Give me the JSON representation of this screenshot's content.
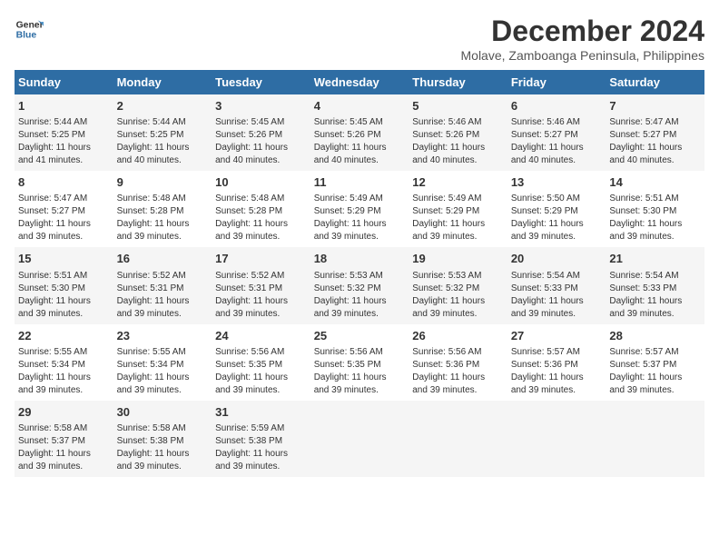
{
  "header": {
    "logo_line1": "General",
    "logo_line2": "Blue",
    "title": "December 2024",
    "subtitle": "Molave, Zamboanga Peninsula, Philippines"
  },
  "calendar": {
    "weekdays": [
      "Sunday",
      "Monday",
      "Tuesday",
      "Wednesday",
      "Thursday",
      "Friday",
      "Saturday"
    ],
    "weeks": [
      [
        {
          "day": "1",
          "info": "Sunrise: 5:44 AM\nSunset: 5:25 PM\nDaylight: 11 hours\nand 41 minutes."
        },
        {
          "day": "2",
          "info": "Sunrise: 5:44 AM\nSunset: 5:25 PM\nDaylight: 11 hours\nand 40 minutes."
        },
        {
          "day": "3",
          "info": "Sunrise: 5:45 AM\nSunset: 5:26 PM\nDaylight: 11 hours\nand 40 minutes."
        },
        {
          "day": "4",
          "info": "Sunrise: 5:45 AM\nSunset: 5:26 PM\nDaylight: 11 hours\nand 40 minutes."
        },
        {
          "day": "5",
          "info": "Sunrise: 5:46 AM\nSunset: 5:26 PM\nDaylight: 11 hours\nand 40 minutes."
        },
        {
          "day": "6",
          "info": "Sunrise: 5:46 AM\nSunset: 5:27 PM\nDaylight: 11 hours\nand 40 minutes."
        },
        {
          "day": "7",
          "info": "Sunrise: 5:47 AM\nSunset: 5:27 PM\nDaylight: 11 hours\nand 40 minutes."
        }
      ],
      [
        {
          "day": "8",
          "info": "Sunrise: 5:47 AM\nSunset: 5:27 PM\nDaylight: 11 hours\nand 39 minutes."
        },
        {
          "day": "9",
          "info": "Sunrise: 5:48 AM\nSunset: 5:28 PM\nDaylight: 11 hours\nand 39 minutes."
        },
        {
          "day": "10",
          "info": "Sunrise: 5:48 AM\nSunset: 5:28 PM\nDaylight: 11 hours\nand 39 minutes."
        },
        {
          "day": "11",
          "info": "Sunrise: 5:49 AM\nSunset: 5:29 PM\nDaylight: 11 hours\nand 39 minutes."
        },
        {
          "day": "12",
          "info": "Sunrise: 5:49 AM\nSunset: 5:29 PM\nDaylight: 11 hours\nand 39 minutes."
        },
        {
          "day": "13",
          "info": "Sunrise: 5:50 AM\nSunset: 5:29 PM\nDaylight: 11 hours\nand 39 minutes."
        },
        {
          "day": "14",
          "info": "Sunrise: 5:51 AM\nSunset: 5:30 PM\nDaylight: 11 hours\nand 39 minutes."
        }
      ],
      [
        {
          "day": "15",
          "info": "Sunrise: 5:51 AM\nSunset: 5:30 PM\nDaylight: 11 hours\nand 39 minutes."
        },
        {
          "day": "16",
          "info": "Sunrise: 5:52 AM\nSunset: 5:31 PM\nDaylight: 11 hours\nand 39 minutes."
        },
        {
          "day": "17",
          "info": "Sunrise: 5:52 AM\nSunset: 5:31 PM\nDaylight: 11 hours\nand 39 minutes."
        },
        {
          "day": "18",
          "info": "Sunrise: 5:53 AM\nSunset: 5:32 PM\nDaylight: 11 hours\nand 39 minutes."
        },
        {
          "day": "19",
          "info": "Sunrise: 5:53 AM\nSunset: 5:32 PM\nDaylight: 11 hours\nand 39 minutes."
        },
        {
          "day": "20",
          "info": "Sunrise: 5:54 AM\nSunset: 5:33 PM\nDaylight: 11 hours\nand 39 minutes."
        },
        {
          "day": "21",
          "info": "Sunrise: 5:54 AM\nSunset: 5:33 PM\nDaylight: 11 hours\nand 39 minutes."
        }
      ],
      [
        {
          "day": "22",
          "info": "Sunrise: 5:55 AM\nSunset: 5:34 PM\nDaylight: 11 hours\nand 39 minutes."
        },
        {
          "day": "23",
          "info": "Sunrise: 5:55 AM\nSunset: 5:34 PM\nDaylight: 11 hours\nand 39 minutes."
        },
        {
          "day": "24",
          "info": "Sunrise: 5:56 AM\nSunset: 5:35 PM\nDaylight: 11 hours\nand 39 minutes."
        },
        {
          "day": "25",
          "info": "Sunrise: 5:56 AM\nSunset: 5:35 PM\nDaylight: 11 hours\nand 39 minutes."
        },
        {
          "day": "26",
          "info": "Sunrise: 5:56 AM\nSunset: 5:36 PM\nDaylight: 11 hours\nand 39 minutes."
        },
        {
          "day": "27",
          "info": "Sunrise: 5:57 AM\nSunset: 5:36 PM\nDaylight: 11 hours\nand 39 minutes."
        },
        {
          "day": "28",
          "info": "Sunrise: 5:57 AM\nSunset: 5:37 PM\nDaylight: 11 hours\nand 39 minutes."
        }
      ],
      [
        {
          "day": "29",
          "info": "Sunrise: 5:58 AM\nSunset: 5:37 PM\nDaylight: 11 hours\nand 39 minutes."
        },
        {
          "day": "30",
          "info": "Sunrise: 5:58 AM\nSunset: 5:38 PM\nDaylight: 11 hours\nand 39 minutes."
        },
        {
          "day": "31",
          "info": "Sunrise: 5:59 AM\nSunset: 5:38 PM\nDaylight: 11 hours\nand 39 minutes."
        },
        {
          "day": "",
          "info": ""
        },
        {
          "day": "",
          "info": ""
        },
        {
          "day": "",
          "info": ""
        },
        {
          "day": "",
          "info": ""
        }
      ]
    ]
  }
}
